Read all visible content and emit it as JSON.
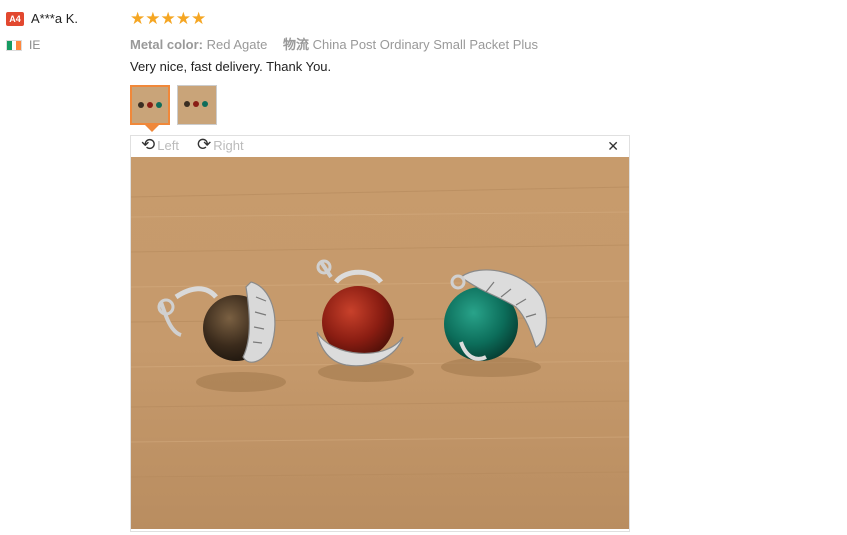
{
  "reviewer": {
    "avatar_label": "A4",
    "name": "A***a K.",
    "country": "IE",
    "flag_colors": [
      "#169b62",
      "#ffffff",
      "#ff883e"
    ]
  },
  "rating": {
    "stars": 5,
    "stars_text": "★★★★★",
    "color": "#f5a623"
  },
  "meta": {
    "color_key": "Metal color:",
    "color_value": "Red Agate",
    "shipping_key": "物流",
    "shipping_value": "China Post Ordinary Small Packet Plus"
  },
  "review": {
    "text": "Very nice, fast delivery. Thank You."
  },
  "thumbnails": [
    {
      "name": "photo-1",
      "selected": true
    },
    {
      "name": "photo-2",
      "selected": false
    }
  ],
  "viewer": {
    "rotate_left_label": "Left",
    "rotate_right_label": "Right",
    "rotate_left_icon": "rotate-left-icon",
    "rotate_right_icon": "rotate-right-icon",
    "close_icon": "close-icon",
    "close_glyph": "✕"
  },
  "colors": {
    "accent": "#f0883a",
    "badge": "#e2482f"
  }
}
